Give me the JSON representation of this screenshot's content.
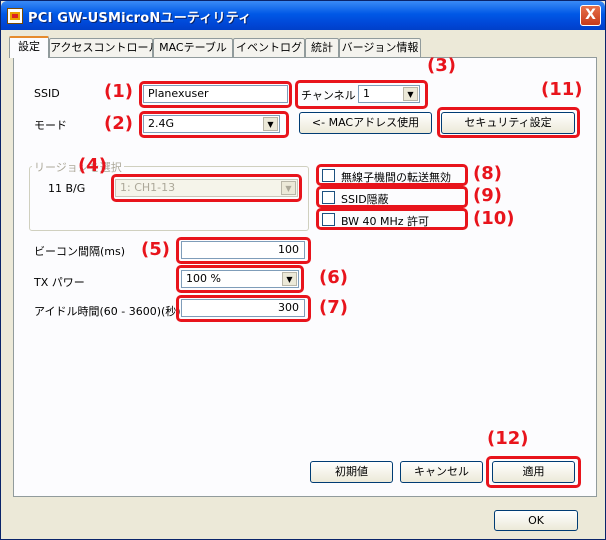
{
  "window": {
    "title": "PCI GW-USMicroNユーティリティ",
    "close_glyph": "X"
  },
  "tabs": [
    {
      "label": "設定"
    },
    {
      "label": "アクセスコントロール"
    },
    {
      "label": "MACテーブル"
    },
    {
      "label": "イベントログ"
    },
    {
      "label": "統計"
    },
    {
      "label": "バージョン情報"
    }
  ],
  "settings": {
    "ssid_label": "SSID",
    "ssid_value": "Planexuser",
    "mode_label": "モード",
    "mode_value": "2.4G",
    "channel_label": "チャンネル",
    "channel_value": "1",
    "mac_button": "<- MACアドレス使用",
    "security_button": "セキュリティ設定",
    "region_group_title": "リージョンを選択",
    "region_label": "11 B/G",
    "region_value": "1: CH1-13",
    "opt_disable_forward": "無線子機間の転送無効",
    "opt_ssid_hide": "SSID隠蔽",
    "opt_bw40": "BW 40 MHz 許可",
    "beacon_label": "ビーコン間隔(ms)",
    "beacon_value": "100",
    "tx_power_label": "TX パワー",
    "tx_power_value": "100 %",
    "idle_label": "アイドル時間(60 - 3600)(秒)",
    "idle_value": "300",
    "default_button": "初期値",
    "cancel_button": "キャンセル",
    "apply_button": "適用"
  },
  "ok_button": "OK",
  "markers": [
    "(1)",
    "(2)",
    "(3)",
    "(4)",
    "(5)",
    "(6)",
    "(7)",
    "(8)",
    "(9)",
    "(10)",
    "(11)",
    "(12)"
  ],
  "colors": {
    "annotation_red": "#e8141c",
    "titlebar_blue": "#0058e6",
    "dialog_bg": "#ece9d8"
  }
}
